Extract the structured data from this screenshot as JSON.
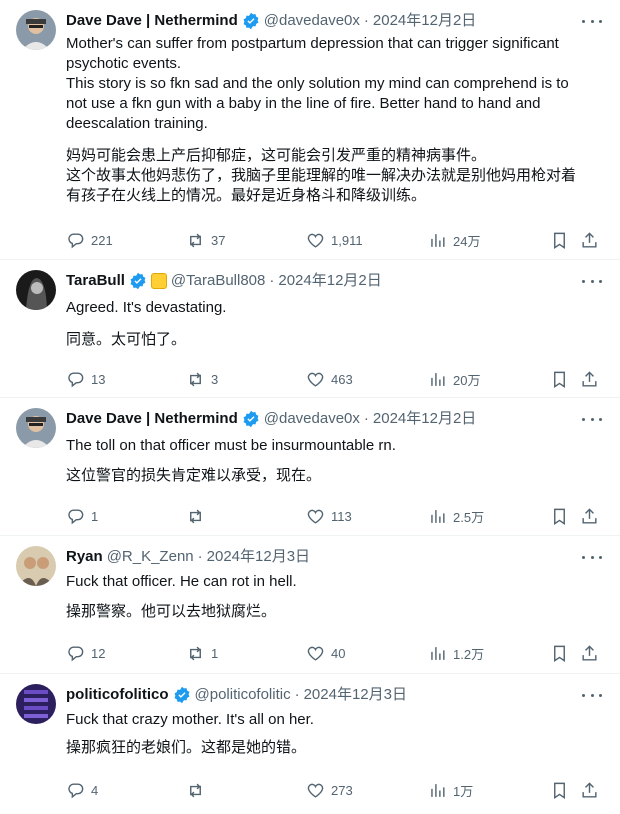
{
  "posts": [
    {
      "name": "Dave Dave | Nethermind",
      "handle": "@davedave0x",
      "date": "2024年12月2日",
      "text_en": "Mother's can suffer from postpartum depression that can trigger significant\npsychotic events.\nThis story is so fkn sad and the only solution my mind can comprehend is to\nnot use a fkn gun with a baby in the line of fire. Better hand to hand and\ndeescalation training.",
      "text_zh": "妈妈可能会患上产后抑郁症，这可能会引发严重的精神病事件。\n这个故事太他妈悲伤了，我脑子里能理解的唯一解决办法就是别他妈用枪对着\n有孩子在火线上的情况。最好是近身格斗和降级训练。",
      "replies": "221",
      "reposts": "37",
      "likes": "1,911",
      "views": "24万"
    },
    {
      "name": "TaraBull",
      "handle": "@TaraBull808",
      "date": "2024年12月2日",
      "text_en": "Agreed. It's devastating.",
      "text_zh": "同意。太可怕了。",
      "replies": "13",
      "reposts": "3",
      "likes": "463",
      "views": "20万"
    },
    {
      "name": "Dave Dave | Nethermind",
      "handle": "@davedave0x",
      "date": "2024年12月2日",
      "text_en": "The toll on that officer must be insurmountable rn.",
      "text_zh": "这位警官的损失肯定难以承受，现在。",
      "replies": "1",
      "reposts": "",
      "likes": "113",
      "views": "2.5万"
    },
    {
      "name": "Ryan",
      "handle": "@R_K_Zenn",
      "date": "2024年12月3日",
      "text_en": "Fuck that officer. He can rot in hell.",
      "text_zh": "操那警察。他可以去地狱腐烂。",
      "replies": "12",
      "reposts": "1",
      "likes": "40",
      "views": "1.2万"
    },
    {
      "name": "politicofolitico",
      "handle": "@politicofolitic",
      "date": "2024年12月3日",
      "text_en": "Fuck that crazy mother. It's all on her.",
      "text_zh": "操那疯狂的老娘们。这都是她的错。",
      "replies": "4",
      "reposts": "",
      "likes": "273",
      "views": "1万"
    }
  ],
  "separator": "·",
  "colors": {
    "text": "#0f1419",
    "secondary": "#536471",
    "verified": "#1d9bf0"
  },
  "icons": [
    "reply-icon",
    "repost-icon",
    "like-icon",
    "views-icon",
    "bookmark-icon",
    "share-icon",
    "more-icon",
    "verified-icon"
  ]
}
